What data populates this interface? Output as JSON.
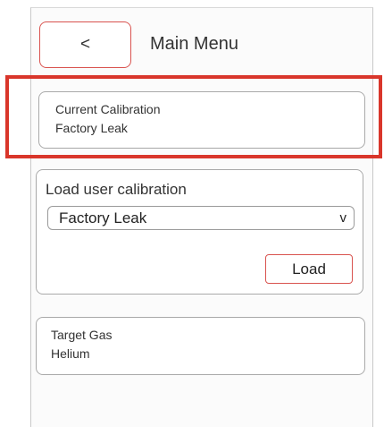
{
  "header": {
    "back_label": "<",
    "title": "Main Menu"
  },
  "current_calibration": {
    "label": "Current Calibration",
    "value": "Factory Leak"
  },
  "load_user_calibration": {
    "title": "Load user calibration",
    "selected": "Factory Leak",
    "dropdown_glyph": "v",
    "load_label": "Load"
  },
  "target_gas": {
    "label": "Target Gas",
    "value": "Helium"
  },
  "colors": {
    "highlight": "#d9362b",
    "button_border": "#d9534f"
  }
}
